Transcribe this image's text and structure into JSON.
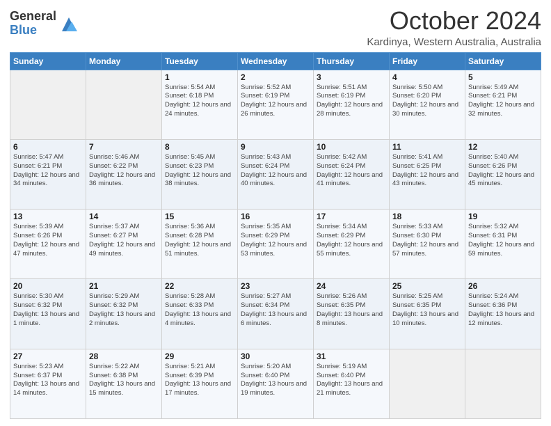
{
  "logo": {
    "general": "General",
    "blue": "Blue"
  },
  "title": "October 2024",
  "location": "Kardinya, Western Australia, Australia",
  "days_of_week": [
    "Sunday",
    "Monday",
    "Tuesday",
    "Wednesday",
    "Thursday",
    "Friday",
    "Saturday"
  ],
  "weeks": [
    [
      {
        "day": "",
        "info": ""
      },
      {
        "day": "",
        "info": ""
      },
      {
        "day": "1",
        "info": "Sunrise: 5:54 AM\nSunset: 6:18 PM\nDaylight: 12 hours and 24 minutes."
      },
      {
        "day": "2",
        "info": "Sunrise: 5:52 AM\nSunset: 6:19 PM\nDaylight: 12 hours and 26 minutes."
      },
      {
        "day": "3",
        "info": "Sunrise: 5:51 AM\nSunset: 6:19 PM\nDaylight: 12 hours and 28 minutes."
      },
      {
        "day": "4",
        "info": "Sunrise: 5:50 AM\nSunset: 6:20 PM\nDaylight: 12 hours and 30 minutes."
      },
      {
        "day": "5",
        "info": "Sunrise: 5:49 AM\nSunset: 6:21 PM\nDaylight: 12 hours and 32 minutes."
      }
    ],
    [
      {
        "day": "6",
        "info": "Sunrise: 5:47 AM\nSunset: 6:21 PM\nDaylight: 12 hours and 34 minutes."
      },
      {
        "day": "7",
        "info": "Sunrise: 5:46 AM\nSunset: 6:22 PM\nDaylight: 12 hours and 36 minutes."
      },
      {
        "day": "8",
        "info": "Sunrise: 5:45 AM\nSunset: 6:23 PM\nDaylight: 12 hours and 38 minutes."
      },
      {
        "day": "9",
        "info": "Sunrise: 5:43 AM\nSunset: 6:24 PM\nDaylight: 12 hours and 40 minutes."
      },
      {
        "day": "10",
        "info": "Sunrise: 5:42 AM\nSunset: 6:24 PM\nDaylight: 12 hours and 41 minutes."
      },
      {
        "day": "11",
        "info": "Sunrise: 5:41 AM\nSunset: 6:25 PM\nDaylight: 12 hours and 43 minutes."
      },
      {
        "day": "12",
        "info": "Sunrise: 5:40 AM\nSunset: 6:26 PM\nDaylight: 12 hours and 45 minutes."
      }
    ],
    [
      {
        "day": "13",
        "info": "Sunrise: 5:39 AM\nSunset: 6:26 PM\nDaylight: 12 hours and 47 minutes."
      },
      {
        "day": "14",
        "info": "Sunrise: 5:37 AM\nSunset: 6:27 PM\nDaylight: 12 hours and 49 minutes."
      },
      {
        "day": "15",
        "info": "Sunrise: 5:36 AM\nSunset: 6:28 PM\nDaylight: 12 hours and 51 minutes."
      },
      {
        "day": "16",
        "info": "Sunrise: 5:35 AM\nSunset: 6:29 PM\nDaylight: 12 hours and 53 minutes."
      },
      {
        "day": "17",
        "info": "Sunrise: 5:34 AM\nSunset: 6:29 PM\nDaylight: 12 hours and 55 minutes."
      },
      {
        "day": "18",
        "info": "Sunrise: 5:33 AM\nSunset: 6:30 PM\nDaylight: 12 hours and 57 minutes."
      },
      {
        "day": "19",
        "info": "Sunrise: 5:32 AM\nSunset: 6:31 PM\nDaylight: 12 hours and 59 minutes."
      }
    ],
    [
      {
        "day": "20",
        "info": "Sunrise: 5:30 AM\nSunset: 6:32 PM\nDaylight: 13 hours and 1 minute."
      },
      {
        "day": "21",
        "info": "Sunrise: 5:29 AM\nSunset: 6:32 PM\nDaylight: 13 hours and 2 minutes."
      },
      {
        "day": "22",
        "info": "Sunrise: 5:28 AM\nSunset: 6:33 PM\nDaylight: 13 hours and 4 minutes."
      },
      {
        "day": "23",
        "info": "Sunrise: 5:27 AM\nSunset: 6:34 PM\nDaylight: 13 hours and 6 minutes."
      },
      {
        "day": "24",
        "info": "Sunrise: 5:26 AM\nSunset: 6:35 PM\nDaylight: 13 hours and 8 minutes."
      },
      {
        "day": "25",
        "info": "Sunrise: 5:25 AM\nSunset: 6:35 PM\nDaylight: 13 hours and 10 minutes."
      },
      {
        "day": "26",
        "info": "Sunrise: 5:24 AM\nSunset: 6:36 PM\nDaylight: 13 hours and 12 minutes."
      }
    ],
    [
      {
        "day": "27",
        "info": "Sunrise: 5:23 AM\nSunset: 6:37 PM\nDaylight: 13 hours and 14 minutes."
      },
      {
        "day": "28",
        "info": "Sunrise: 5:22 AM\nSunset: 6:38 PM\nDaylight: 13 hours and 15 minutes."
      },
      {
        "day": "29",
        "info": "Sunrise: 5:21 AM\nSunset: 6:39 PM\nDaylight: 13 hours and 17 minutes."
      },
      {
        "day": "30",
        "info": "Sunrise: 5:20 AM\nSunset: 6:40 PM\nDaylight: 13 hours and 19 minutes."
      },
      {
        "day": "31",
        "info": "Sunrise: 5:19 AM\nSunset: 6:40 PM\nDaylight: 13 hours and 21 minutes."
      },
      {
        "day": "",
        "info": ""
      },
      {
        "day": "",
        "info": ""
      }
    ]
  ]
}
